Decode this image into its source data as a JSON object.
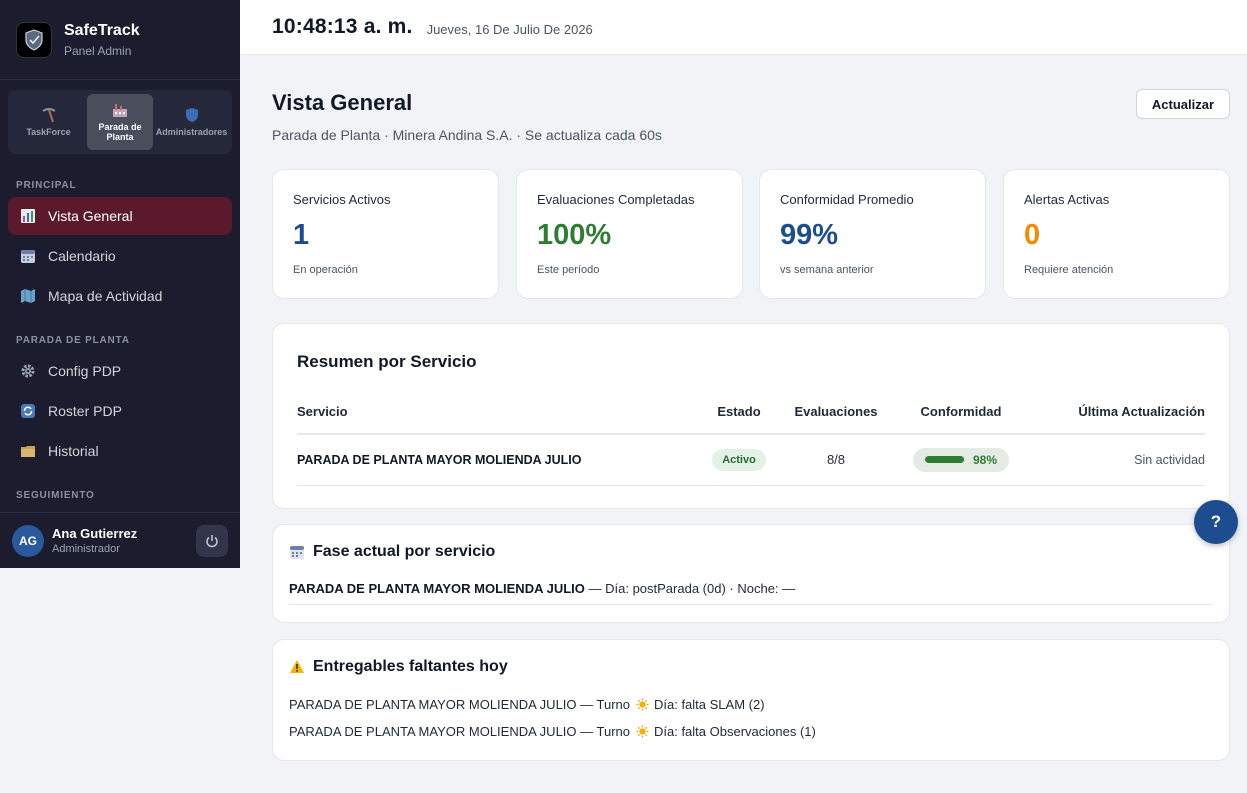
{
  "brand": {
    "title": "SafeTrack",
    "subtitle": "Panel Admin",
    "logo_text": "SafeTrack"
  },
  "switcher": [
    {
      "label": "TaskForce",
      "icon": "pickaxe-icon",
      "active": false
    },
    {
      "label": "Parada de Planta",
      "icon": "factory-icon",
      "active": true
    },
    {
      "label": "Administradores",
      "icon": "shield-icon",
      "active": false
    }
  ],
  "sections": {
    "principal": "PRINCIPAL",
    "parada": "PARADA DE PLANTA",
    "seguimiento": "SEGUIMIENTO"
  },
  "nav": {
    "principal": [
      {
        "label": "Vista General",
        "icon": "bar-chart-icon",
        "active": true
      },
      {
        "label": "Calendario",
        "icon": "calendar-icon",
        "active": false
      },
      {
        "label": "Mapa de Actividad",
        "icon": "map-icon",
        "active": false
      }
    ],
    "parada": [
      {
        "label": "Config PDP",
        "icon": "gear-icon",
        "active": false
      },
      {
        "label": "Roster PDP",
        "icon": "refresh-icon",
        "active": false
      },
      {
        "label": "Historial",
        "icon": "folder-icon",
        "active": false
      }
    ]
  },
  "user": {
    "initials": "AG",
    "name": "Ana Gutierrez",
    "role": "Administrador"
  },
  "topbar": {
    "time": "10:48:13 a. m.",
    "date": "Jueves, 16 De Julio De 2026"
  },
  "page": {
    "title": "Vista General",
    "subtitle": "Parada de Planta · Minera Andina S.A. · Se actualiza cada 60s",
    "refresh_label": "Actualizar"
  },
  "stats": [
    {
      "label": "Servicios Activos",
      "value": "1",
      "note": "En operación",
      "color": "#1e4d8f"
    },
    {
      "label": "Evaluaciones Completadas",
      "value": "100%",
      "note": "Este período",
      "color": "#2e7d32"
    },
    {
      "label": "Conformidad Promedio",
      "value": "99%",
      "note": "vs semana anterior",
      "color": "#1e4d8f"
    },
    {
      "label": "Alertas Activas",
      "value": "0",
      "note": "Requiere atención",
      "color": "#f08c00"
    }
  ],
  "summary": {
    "title": "Resumen por Servicio",
    "columns": [
      "Servicio",
      "Estado",
      "Evaluaciones",
      "Conformidad",
      "Última Actualización"
    ],
    "rows": [
      {
        "service": "PARADA DE PLANTA MAYOR MOLIENDA JULIO",
        "status": "Activo",
        "evaluations": "8/8",
        "conformity": "98%",
        "conformity_value": 98,
        "updated": "Sin actividad"
      }
    ]
  },
  "phase": {
    "title": "Fase actual por servicio",
    "rows": [
      {
        "service": "PARADA DE PLANTA MAYOR MOLIENDA JULIO",
        "detail": " — Día: postParada (0d) · Noche: —"
      }
    ]
  },
  "deliverables": {
    "title": "Entregables faltantes hoy",
    "rows": [
      {
        "prefix": "PARADA DE PLANTA MAYOR MOLIENDA JULIO — Turno",
        "suffix": "Día: falta SLAM (2)"
      },
      {
        "prefix": "PARADA DE PLANTA MAYOR MOLIENDA JULIO — Turno",
        "suffix": "Día: falta Observaciones (1)"
      }
    ]
  },
  "help": {
    "label": "?"
  }
}
